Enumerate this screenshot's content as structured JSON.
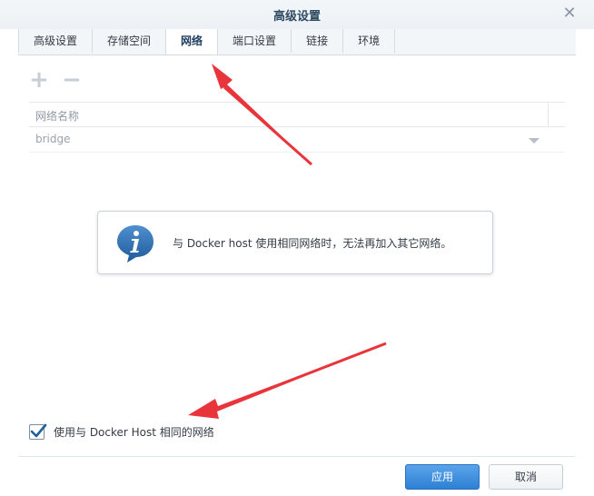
{
  "window": {
    "title": "高级设置",
    "close_icon": "close-icon"
  },
  "tabs": [
    {
      "label": "高级设置",
      "active": false
    },
    {
      "label": "存储空间",
      "active": false
    },
    {
      "label": "网络",
      "active": true
    },
    {
      "label": "端口设置",
      "active": false
    },
    {
      "label": "链接",
      "active": false
    },
    {
      "label": "环境",
      "active": false
    }
  ],
  "toolbar": {
    "add_icon": "plus-icon",
    "remove_icon": "minus-icon"
  },
  "grid": {
    "columns": [
      "网络名称"
    ],
    "rows": [
      [
        "bridge"
      ]
    ]
  },
  "info": {
    "icon": "info-icon",
    "message": "与 Docker host 使用相同网络时，无法再加入其它网络。"
  },
  "host_network": {
    "label": "使用与 Docker Host 相同的网络",
    "checked": true
  },
  "footer": {
    "apply_label": "应用",
    "cancel_label": "取消"
  },
  "colors": {
    "primary_button": "#2e80d4",
    "annotation_arrow": "#e8353b",
    "info_icon": "#2f6fb1"
  }
}
